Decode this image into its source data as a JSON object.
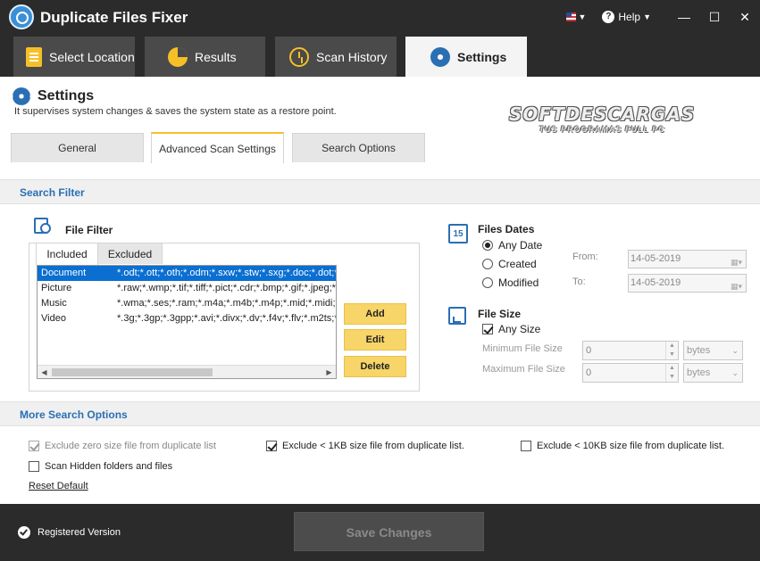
{
  "app": {
    "title": "Duplicate Files Fixer",
    "help_label": "Help",
    "window_controls": {
      "minimize": "—",
      "maximize": "☐",
      "close": "✕"
    }
  },
  "main_tabs": [
    {
      "label": "Select Location",
      "icon": "document-icon"
    },
    {
      "label": "Results",
      "icon": "pie-chart-icon"
    },
    {
      "label": "Scan History",
      "icon": "clock-icon"
    },
    {
      "label": "Settings",
      "icon": "gear-icon",
      "active": true
    }
  ],
  "settings": {
    "title": "Settings",
    "subtitle": "It supervises system changes & saves the system state as a restore point."
  },
  "watermark": {
    "line1": "SOFTDESCARGAS",
    "line2": "TUS PROGRAMAS FULL PC"
  },
  "sub_tabs": [
    {
      "label": "General"
    },
    {
      "label": "Advanced Scan Settings",
      "active": true
    },
    {
      "label": "Search Options"
    }
  ],
  "search_filter": {
    "section_title": "Search Filter",
    "file_filter": {
      "label": "File Filter",
      "tabs": [
        {
          "label": "Included",
          "active": true
        },
        {
          "label": "Excluded"
        }
      ],
      "rows": [
        {
          "name": "Document",
          "ext": "*.odt;*.ott;*.oth;*.odm;*.sxw;*.stw;*.sxg;*.doc;*.dot;*",
          "selected": true
        },
        {
          "name": "Picture",
          "ext": "*.raw;*.wmp;*.tif;*.tiff;*.pict;*.cdr;*.bmp;*.gif;*.jpeg;*"
        },
        {
          "name": "Music",
          "ext": "*.wma;*.ses;*.ram;*.m4a;*.m4b;*.m4p;*.mid;*.midi;*"
        },
        {
          "name": "Video",
          "ext": "*.3g;*.3gp;*.3gpp;*.avi;*.divx;*.dv;*.f4v;*.flv;*.m2ts;*"
        }
      ],
      "buttons": {
        "add": "Add",
        "edit": "Edit",
        "delete": "Delete"
      }
    },
    "files_dates": {
      "label": "Files Dates",
      "icon_text": "15",
      "options": [
        {
          "label": "Any Date",
          "selected": true
        },
        {
          "label": "Created"
        },
        {
          "label": "Modified"
        }
      ],
      "from_label": "From:",
      "to_label": "To:",
      "from_value": "14-05-2019",
      "to_value": "14-05-2019"
    },
    "file_size": {
      "label": "File Size",
      "any_size_label": "Any Size",
      "any_size_checked": true,
      "min_label": "Minimum File Size",
      "max_label": "Maximum File Size",
      "min_value": "0",
      "max_value": "0",
      "min_unit": "bytes",
      "max_unit": "bytes"
    }
  },
  "more_search": {
    "section_title": "More Search Options",
    "exclude_zero": {
      "label": "Exclude zero size file from duplicate list",
      "checked": true,
      "disabled": true
    },
    "exclude_1kb": {
      "label": "Exclude < 1KB size file from duplicate list.",
      "checked": true
    },
    "exclude_10kb": {
      "label": "Exclude < 10KB size file from duplicate list.",
      "checked": false
    },
    "scan_hidden": {
      "label": "Scan Hidden folders and files",
      "checked": false
    },
    "reset_label": "Reset Default"
  },
  "footer": {
    "registered_label": "Registered Version",
    "save_label": "Save Changes"
  },
  "colors": {
    "accent_blue": "#2a6fb4",
    "button_yellow": "#f7d568",
    "dark_chrome": "#2b2b2b",
    "selection_blue": "#0a6fd1"
  }
}
